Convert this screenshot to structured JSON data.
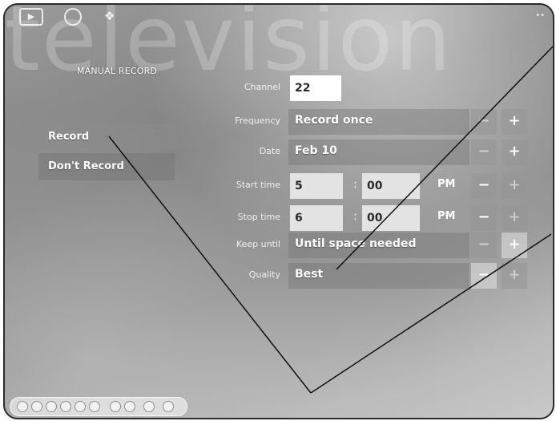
{
  "watermark": "television",
  "page_title": "MANUAL RECORD",
  "top_icons": [
    "media-icon",
    "back-icon",
    "home-icon"
  ],
  "sidebar": {
    "items": [
      {
        "label": "Record",
        "selected": true
      },
      {
        "label": "Don't Record",
        "selected": false
      }
    ]
  },
  "form": {
    "channel": {
      "label": "Channel",
      "value": "22"
    },
    "frequency": {
      "label": "Frequency",
      "value": "Record once",
      "minus": "−",
      "plus": "+"
    },
    "date": {
      "label": "Date",
      "value": "Feb 10",
      "minus": "−",
      "plus": "+"
    },
    "start_time": {
      "label": "Start time",
      "hour": "5",
      "minute": "00",
      "separator": ":",
      "ampm": "PM",
      "minus": "−",
      "plus": "+"
    },
    "stop_time": {
      "label": "Stop time",
      "hour": "6",
      "minute": "00",
      "separator": ":",
      "ampm": "PM",
      "minus": "−",
      "plus": "+"
    },
    "keep_until": {
      "label": "Keep until",
      "value": "Until space needed",
      "minus": "−",
      "plus": "+"
    },
    "quality": {
      "label": "Quality",
      "value": "Best",
      "minus": "−",
      "plus": "+"
    }
  }
}
